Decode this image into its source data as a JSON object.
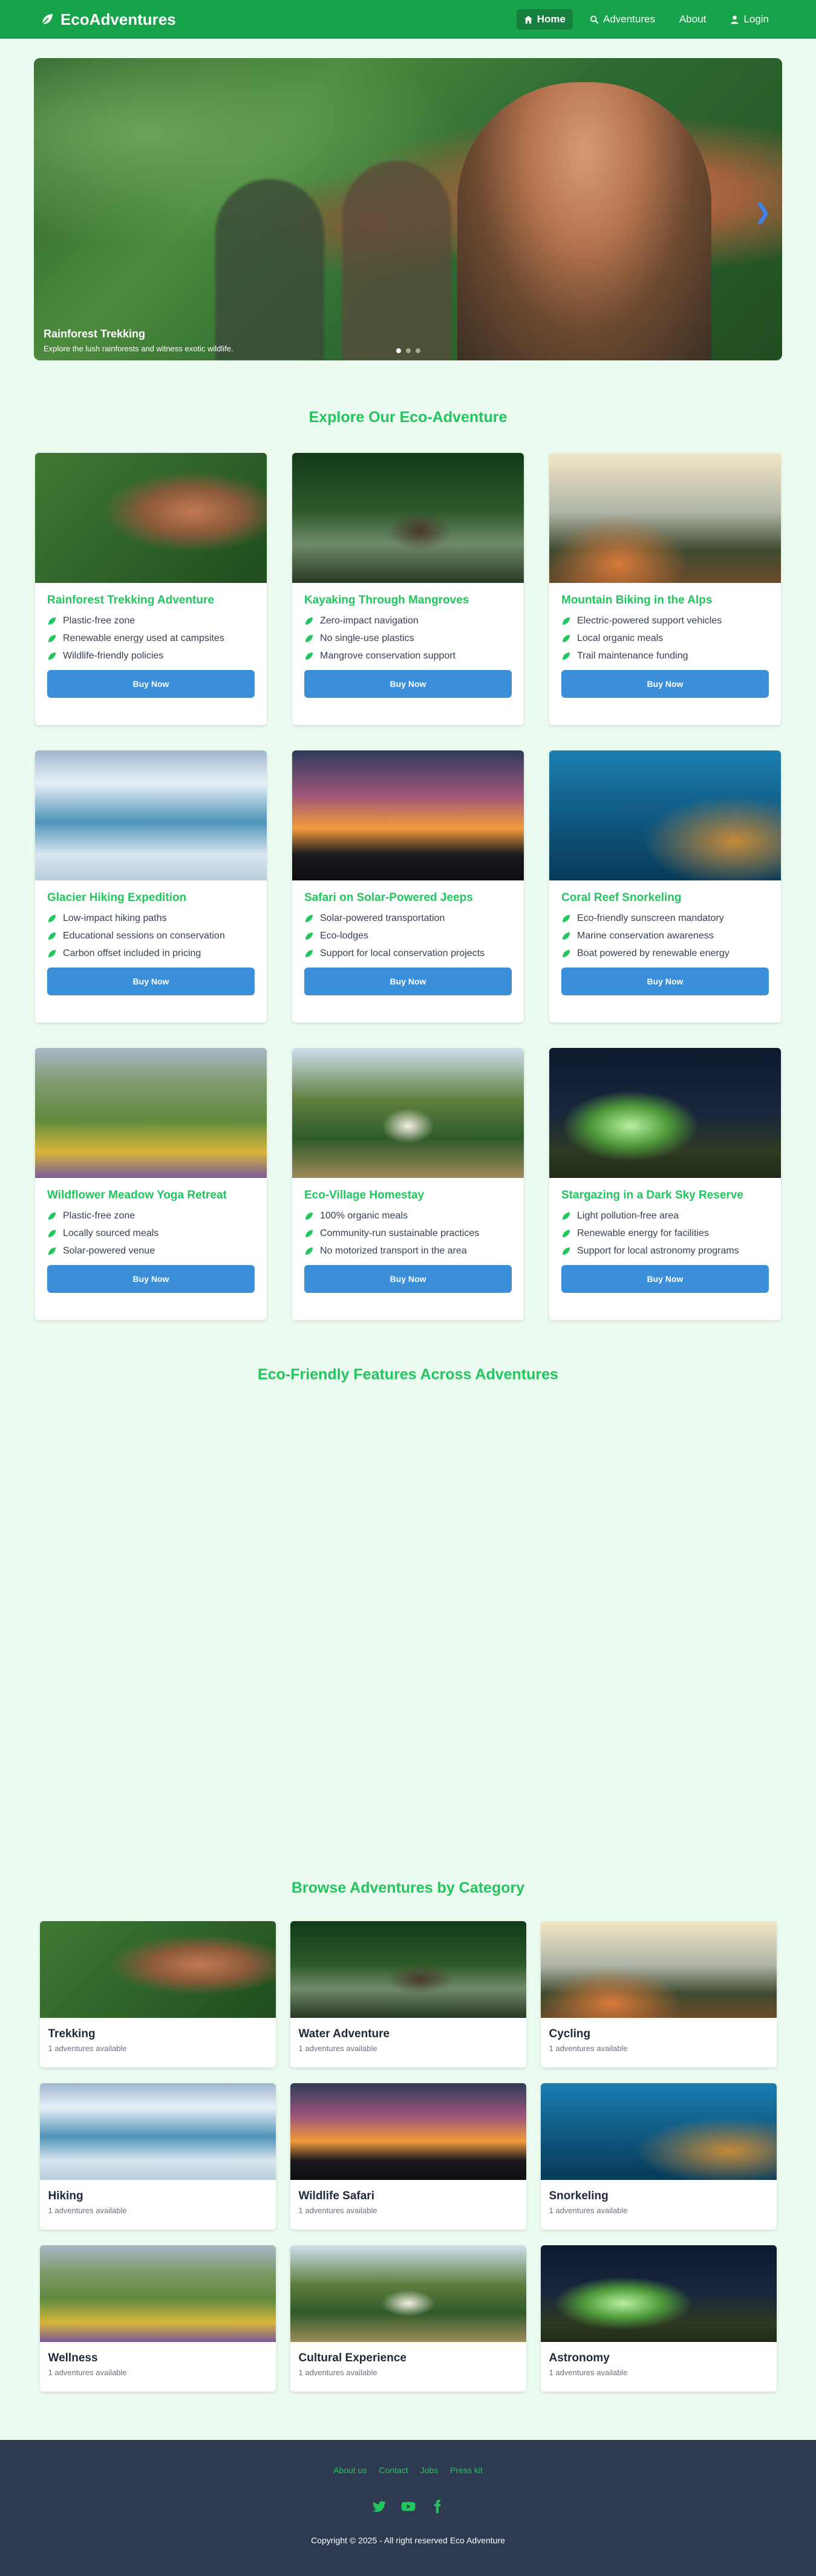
{
  "nav": {
    "brand": "EcoAdventures",
    "links": [
      {
        "label": "Home",
        "icon": "home-icon"
      },
      {
        "label": "Adventures",
        "icon": "search-icon"
      },
      {
        "label": "About",
        "icon": ""
      },
      {
        "label": "Login",
        "icon": "user-icon"
      }
    ]
  },
  "hero": {
    "title": "Rainforest Trekking",
    "subtitle": "Explore the lush rainforests and witness exotic wildlife."
  },
  "explore": {
    "title": "Explore Our Eco-Adventure",
    "buy_label": "Buy Now",
    "cards": [
      {
        "title": "Rainforest Trekking Adventure",
        "features": [
          "Plastic-free zone",
          "Renewable energy used at campsites",
          "Wildlife-friendly policies"
        ]
      },
      {
        "title": "Kayaking Through Mangroves",
        "features": [
          "Zero-impact navigation",
          "No single-use plastics",
          "Mangrove conservation support"
        ]
      },
      {
        "title": "Mountain Biking in the Alps",
        "features": [
          "Electric-powered support vehicles",
          "Local organic meals",
          "Trail maintenance funding"
        ]
      },
      {
        "title": "Glacier Hiking Expedition",
        "features": [
          "Low-impact hiking paths",
          "Educational sessions on conservation",
          "Carbon offset included in pricing"
        ]
      },
      {
        "title": "Safari on Solar-Powered Jeeps",
        "features": [
          "Solar-powered transportation",
          "Eco-lodges",
          "Support for local conservation projects"
        ]
      },
      {
        "title": "Coral Reef Snorkeling",
        "features": [
          "Eco-friendly sunscreen mandatory",
          "Marine conservation awareness",
          "Boat powered by renewable energy"
        ]
      },
      {
        "title": "Wildflower Meadow Yoga Retreat",
        "features": [
          "Plastic-free zone",
          "Locally sourced meals",
          "Solar-powered venue"
        ]
      },
      {
        "title": "Eco-Village Homestay",
        "features": [
          "100% organic meals",
          "Community-run sustainable practices",
          "No motorized transport in the area"
        ]
      },
      {
        "title": "Stargazing in a Dark Sky Reserve",
        "features": [
          "Light pollution-free area",
          "Renewable energy for facilities",
          "Support for local astronomy programs"
        ]
      }
    ]
  },
  "features_section": {
    "title": "Eco-Friendly Features Across Adventures"
  },
  "categories": {
    "title": "Browse Adventures by Category",
    "items": [
      {
        "name": "Trekking",
        "count": "1 adventures available"
      },
      {
        "name": "Water Adventure",
        "count": "1 adventures available"
      },
      {
        "name": "Cycling",
        "count": "1 adventures available"
      },
      {
        "name": "Hiking",
        "count": "1 adventures available"
      },
      {
        "name": "Wildlife Safari",
        "count": "1 adventures available"
      },
      {
        "name": "Snorkeling",
        "count": "1 adventures available"
      },
      {
        "name": "Wellness",
        "count": "1 adventures available"
      },
      {
        "name": "Cultural Experience",
        "count": "1 adventures available"
      },
      {
        "name": "Astronomy",
        "count": "1 adventures available"
      }
    ]
  },
  "footer": {
    "links": [
      "About us",
      "Contact",
      "Jobs",
      "Press kit"
    ],
    "socials": [
      "twitter-icon",
      "youtube-icon",
      "facebook-icon"
    ],
    "copyright": "Copyright © 2025 - All right reserved Eco Adventure"
  },
  "colors": {
    "brand_green": "#16a34a",
    "accent_green": "#22c55e",
    "button_blue": "#3b8fd9",
    "footer_bg": "#2d3a4f",
    "page_bg": "#ecfbf0"
  }
}
